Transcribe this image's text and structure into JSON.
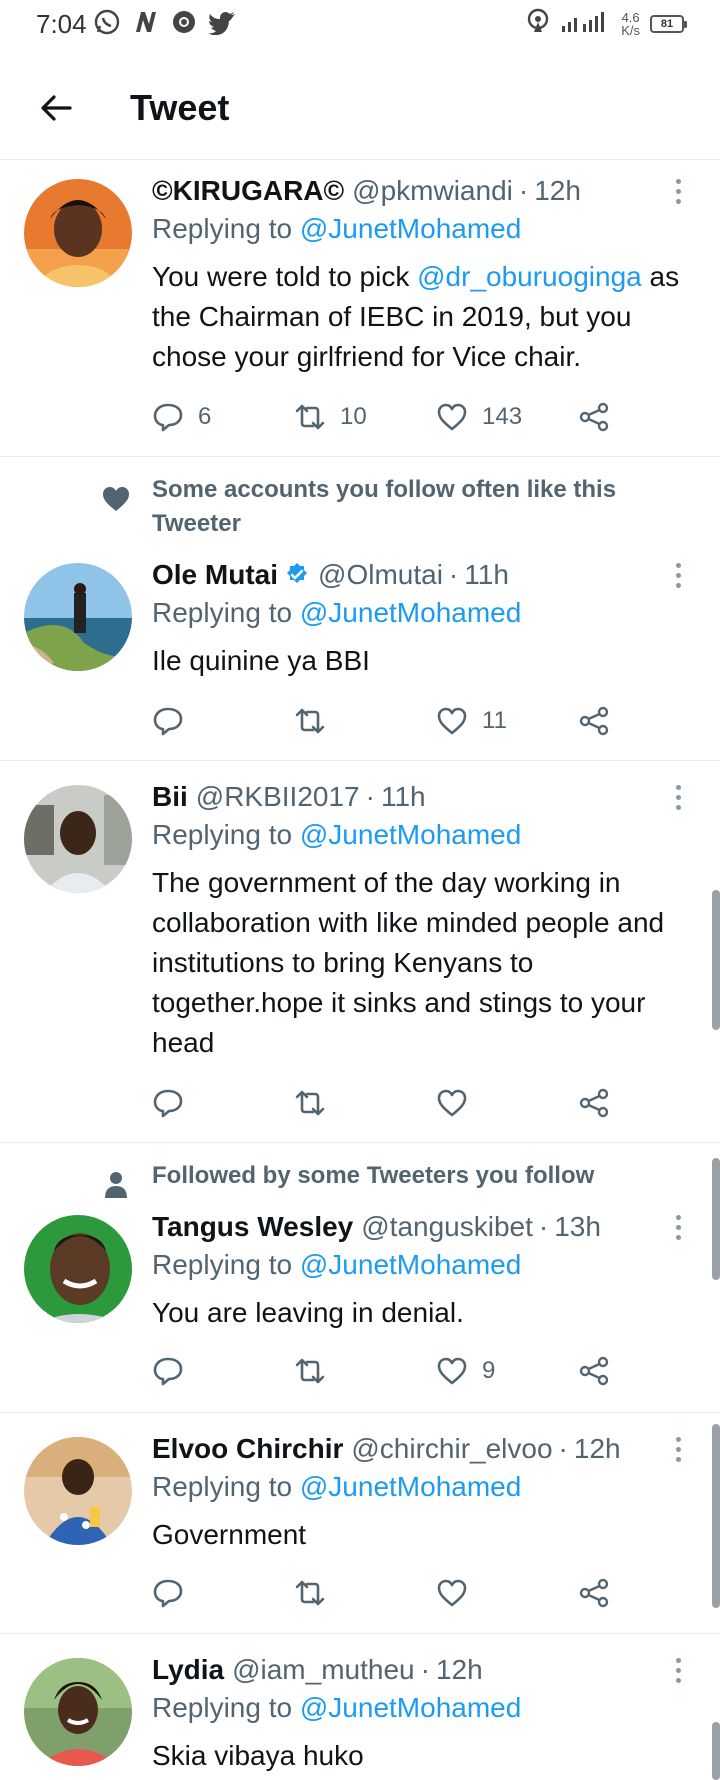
{
  "status_bar": {
    "time": "7:04",
    "net_top": "4.6",
    "net_bottom": "K/s",
    "signal_label": "4G",
    "battery": "81"
  },
  "header": {
    "title": "Tweet"
  },
  "replying_prefix": "Replying to",
  "tweets": [
    {
      "name": "©KIRUGARA©",
      "handle": "@pkmwiandi",
      "time": "12h",
      "reply_to": "@JunetMohamed",
      "text_lines": [
        "You were told to pick ",
        "@dr_oburuoginga",
        " as the Chairman of IEBC in 2019, but you chose your girlfriend for Vice chair."
      ],
      "replies": "6",
      "retweets": "10",
      "likes": "143"
    },
    {
      "social_context": "Some accounts you follow often like this Tweeter",
      "name": "Ole Mutai",
      "handle": "@Olmutai",
      "time": "11h",
      "reply_to": "@JunetMohamed",
      "text": "Ile quinine ya BBI",
      "replies": "",
      "retweets": "",
      "likes": "11"
    },
    {
      "name": "Bii",
      "handle": "@RKBII2017",
      "time": "11h",
      "reply_to": "@JunetMohamed",
      "text": "The government of the day working in collaboration with like minded people and institutions to bring Kenyans to together.hope it sinks and stings to your head",
      "replies": "",
      "retweets": "",
      "likes": ""
    },
    {
      "social_context": "Followed by some Tweeters you follow",
      "name": "Tangus Wesley",
      "handle": "@tanguskibet",
      "time": "13h",
      "reply_to": "@JunetMohamed",
      "text": "You are leaving in denial.",
      "replies": "",
      "retweets": "",
      "likes": "9"
    },
    {
      "name": "Elvoo Chirchir",
      "handle": "@chirchir_elvoo",
      "time": "12h",
      "reply_to": "@JunetMohamed",
      "text": "Government",
      "replies": "",
      "retweets": "",
      "likes": ""
    },
    {
      "name": "Lydia",
      "handle": "@iam_mutheu",
      "time": "12h",
      "reply_to": "@JunetMohamed",
      "text": "Skia vibaya huko"
    }
  ],
  "colors": {
    "accent": "#1d9bf0",
    "muted": "#536471",
    "text": "#0f1419"
  }
}
